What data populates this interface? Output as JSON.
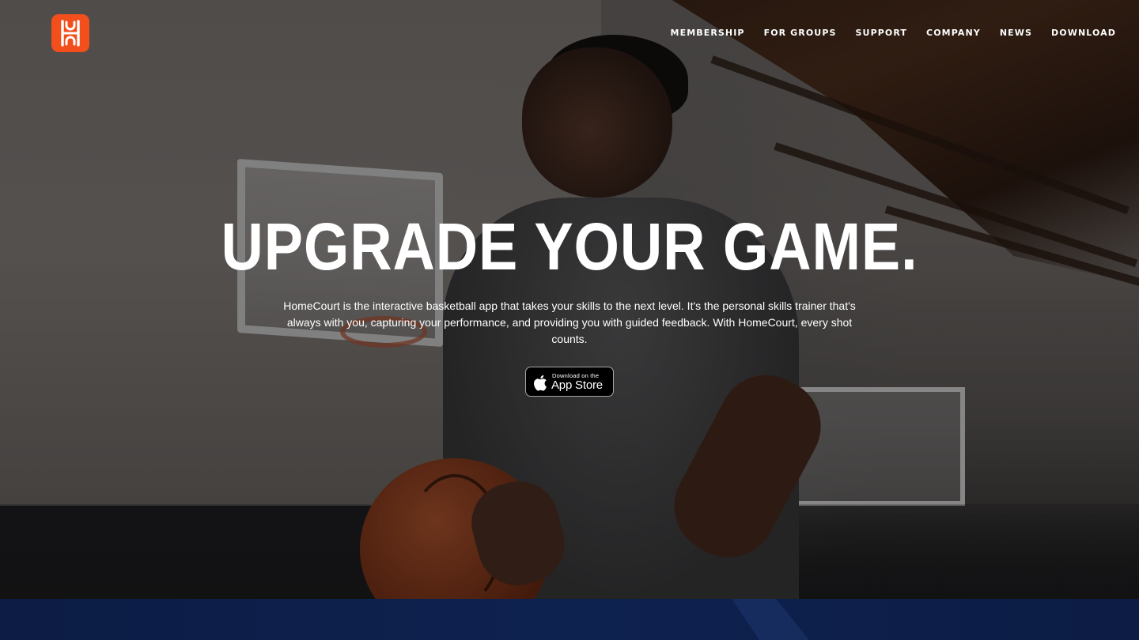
{
  "brand": {
    "logo_icon": "homecourt-logo-icon",
    "accent_color": "#f24f1c"
  },
  "nav": {
    "items": [
      {
        "label": "MEMBERSHIP"
      },
      {
        "label": "FOR GROUPS"
      },
      {
        "label": "SUPPORT"
      },
      {
        "label": "COMPANY"
      },
      {
        "label": "NEWS"
      },
      {
        "label": "DOWNLOAD"
      }
    ]
  },
  "hero": {
    "headline": "UPGRADE YOUR GAME.",
    "description": "HomeCourt is the interactive basketball app that takes your skills to the next level. It's the personal skills trainer that's always with you, capturing your performance, and providing you with guided feedback. With HomeCourt, every shot counts.",
    "appstore": {
      "icon": "apple-icon",
      "small_label": "Download on the",
      "big_label": "App Store"
    }
  },
  "colors": {
    "next_section_bg": "#0e2250",
    "text": "#ffffff"
  }
}
